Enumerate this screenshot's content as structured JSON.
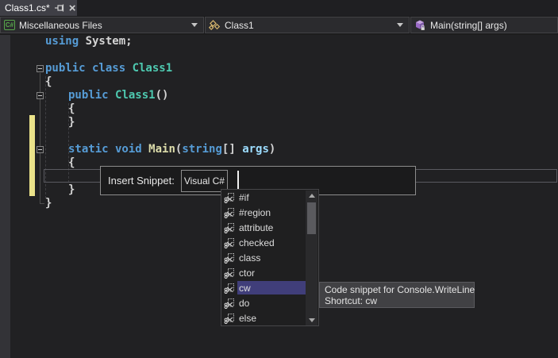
{
  "window": {
    "tab_title": "Class1.cs*"
  },
  "navbar": {
    "file_dropdown": "Miscellaneous Files",
    "type_dropdown": "Class1",
    "member_dropdown": "Main(string[] args)"
  },
  "code": {
    "lines": [
      {
        "indent": 0,
        "tokens": [
          {
            "text": "using ",
            "color": "keyword"
          },
          {
            "text": "System;",
            "color": "plain"
          }
        ]
      },
      {
        "blank": true
      },
      {
        "indent": 0,
        "tokens": [
          {
            "text": "public class ",
            "color": "keyword"
          },
          {
            "text": "Class1",
            "color": "type"
          }
        ]
      },
      {
        "indent": 0,
        "tokens": [
          {
            "text": "{",
            "color": "plain"
          }
        ]
      },
      {
        "indent": 1,
        "tokens": [
          {
            "text": "public ",
            "color": "keyword"
          },
          {
            "text": "Class1",
            "color": "type"
          },
          {
            "text": "()",
            "color": "plain"
          }
        ]
      },
      {
        "indent": 1,
        "tokens": [
          {
            "text": "{",
            "color": "plain"
          }
        ]
      },
      {
        "indent": 1,
        "tokens": [
          {
            "text": "}",
            "color": "plain"
          }
        ]
      },
      {
        "blank": true
      },
      {
        "indent": 1,
        "tokens": [
          {
            "text": "static void ",
            "color": "keyword"
          },
          {
            "text": "Main",
            "color": "method"
          },
          {
            "text": "(",
            "color": "plain"
          },
          {
            "text": "string",
            "color": "keyword"
          },
          {
            "text": "[] ",
            "color": "plain"
          },
          {
            "text": "args",
            "color": "param"
          },
          {
            "text": ")",
            "color": "plain"
          }
        ]
      },
      {
        "indent": 1,
        "tokens": [
          {
            "text": "{",
            "color": "plain"
          }
        ]
      },
      {
        "blank": true,
        "current": true
      },
      {
        "indent": 1,
        "tokens": [
          {
            "text": "}",
            "color": "plain"
          }
        ]
      },
      {
        "indent": 0,
        "tokens": [
          {
            "text": "}",
            "color": "plain"
          }
        ]
      }
    ]
  },
  "snippet_popup": {
    "label": "Insert Snippet:",
    "scope": "Visual C#"
  },
  "snippet_list": {
    "items": [
      "#if",
      "#region",
      "attribute",
      "checked",
      "class",
      "ctor",
      "cw",
      "do",
      "else"
    ],
    "selected_index": 6
  },
  "tooltip": {
    "line1": "Code snippet for Console.WriteLine",
    "line2": "Shortcut: cw"
  },
  "colors": {
    "keyword": "#569CD6",
    "type": "#4EC9B0",
    "plain": "#D4D4D4",
    "method": "#DCDCAA",
    "param": "#9CDCFE",
    "selection": "#403E7A",
    "changed_line_bar": "#EBE38A",
    "csharp_green": "#57A64A",
    "class_icon_gold": "#D6B66D",
    "method_icon_purple": "#9B6BC7"
  }
}
